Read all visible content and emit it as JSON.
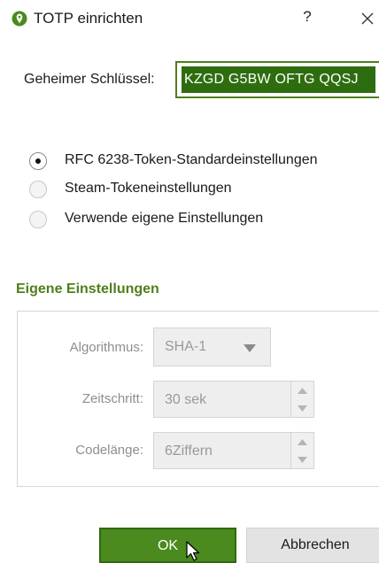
{
  "dialog": {
    "title": "TOTP einrichten",
    "help_label": "?",
    "icon": "keepass-logo-icon",
    "accent_color": "#4e7f1c"
  },
  "secret": {
    "label": "Geheimer Schlüssel:",
    "value": "KZGD G5BW OFTG QQSJ"
  },
  "presets": {
    "selected": 0,
    "options": [
      {
        "label": "RFC 6238-Token-Standardeinstellungen"
      },
      {
        "label": "Steam-Tokeneinstellungen"
      },
      {
        "label": "Verwende eigene Einstellungen"
      }
    ]
  },
  "custom": {
    "heading": "Eigene Einstellungen",
    "algorithm_label": "Algorithmus:",
    "algorithm_value": "SHA-1",
    "timestep_label": "Zeitschritt:",
    "timestep_value": "30 sek",
    "digits_label": "Codelänge:",
    "digits_value": "6Ziffern",
    "enabled": false
  },
  "buttons": {
    "ok": "OK",
    "cancel": "Abbrechen"
  }
}
